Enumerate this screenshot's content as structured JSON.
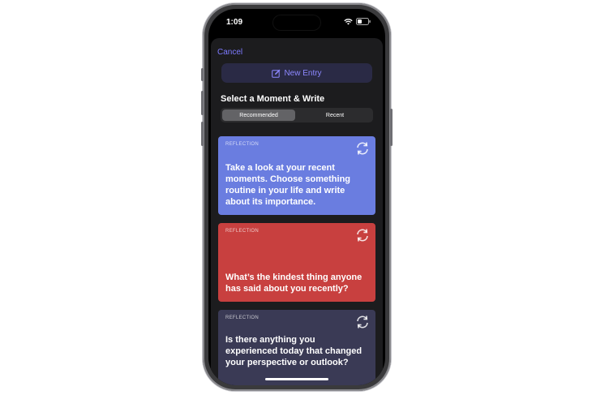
{
  "status_bar": {
    "time": "1:09"
  },
  "sheet": {
    "cancel_label": "Cancel",
    "new_entry_label": "New Entry",
    "section_title": "Select a Moment & Write",
    "segments": [
      {
        "label": "Recommended",
        "selected": true
      },
      {
        "label": "Recent",
        "selected": false
      }
    ]
  },
  "cards": [
    {
      "kicker": "REFLECTION",
      "prompt": "Take a look at your recent moments. Choose something routine in your life and write about its importance.",
      "color": "#6a7de0"
    },
    {
      "kicker": "REFLECTION",
      "prompt": "What’s the kindest thing anyone has said about you recently?",
      "color": "#c8403f"
    },
    {
      "kicker": "REFLECTION",
      "prompt": "Is there anything you experienced today that changed your perspective or outlook?",
      "color": "#3a3a55"
    }
  ],
  "colors": {
    "accent": "#7d7aff",
    "sheet_bg": "#1c1c1e"
  },
  "icons": {
    "new_entry": "compose-icon",
    "refresh": "refresh-icon",
    "wifi": "wifi-icon",
    "battery": "battery-icon"
  }
}
